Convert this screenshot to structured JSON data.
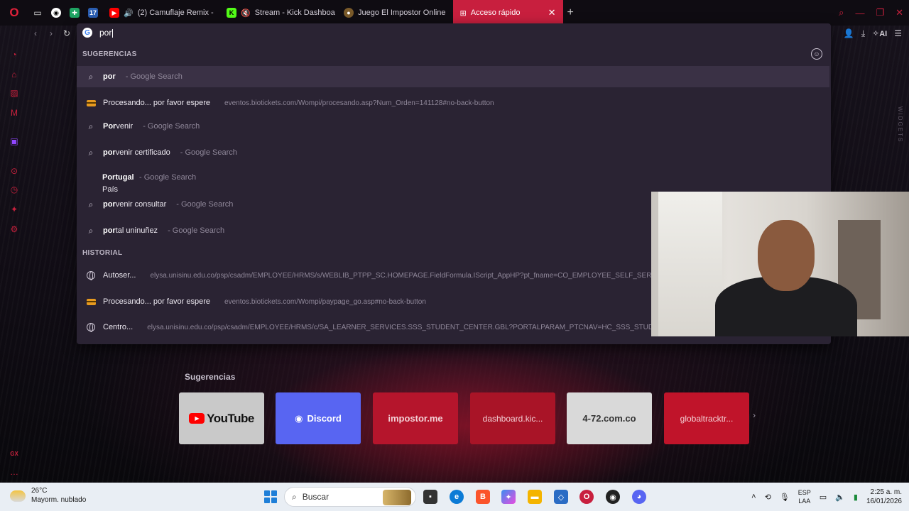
{
  "tabs": [
    {
      "title": "(2) Camuflaje Remix -",
      "favicon": "youtube-icon",
      "color": "#ff0000",
      "muted": false
    },
    {
      "title": "Stream - Kick Dashboa",
      "favicon": "kick-icon",
      "color": "#53fc18",
      "muted": true
    },
    {
      "title": "Juego El Impostor Online",
      "favicon": "impostor-icon",
      "color": "#7a5a2a",
      "muted": false
    },
    {
      "title": "Acceso rápido",
      "favicon": "speed-dial-icon",
      "color": "#c81f3e",
      "active": true
    }
  ],
  "pinned_tabs": [
    "tab-manager-icon",
    "chatgpt-icon",
    "sheets-icon",
    "seventeen-icon"
  ],
  "omnibox": {
    "typed_text": "por",
    "suggestions_header": "SUGERENCIAS",
    "history_header": "HISTORIAL",
    "suggestions": [
      {
        "bold": "por",
        "rest": "",
        "sub": "- Google Search",
        "icon": "search-icon",
        "selected": true
      },
      {
        "bold": "Procesando... por favor espere",
        "rest": "",
        "sub": "eventos.biotickets.com/Wompi/procesando.asp?Num_Orden=141128#no-back-button",
        "icon": "card-icon",
        "url": true
      },
      {
        "bold": "Por",
        "rest": "venir",
        "sub": "- Google Search",
        "icon": "search-icon"
      },
      {
        "bold": "por",
        "rest": "venir certificado",
        "sub": "- Google Search",
        "icon": "search-icon"
      },
      {
        "bold": "Portugal",
        "rest": "",
        "sub": "- Google Search",
        "icon": "none",
        "second_line": "País"
      },
      {
        "bold": "por",
        "rest": "venir consultar",
        "sub": "- Google Search",
        "icon": "search-icon"
      },
      {
        "bold": "por",
        "rest": "tal uninuñez",
        "sub": "- Google Search",
        "icon": "search-icon"
      }
    ],
    "history": [
      {
        "title": "Autoser...",
        "url": "elysa.unisinu.edu.co/psp/csadm/EMPLOYEE/HRMS/s/WEBLIB_PTPP_SC.HOMEPAGE.FieldFormula.IScript_AppHP?pt_fname=CO_EMPLOYEE_SELF_SERV",
        "icon": "globe-icon"
      },
      {
        "title": "Procesando... por favor espere",
        "url": "eventos.biotickets.com/Wompi/paypage_go.asp#no-back-button",
        "icon": "card-icon"
      },
      {
        "title": "Centro...",
        "url": "elysa.unisinu.edu.co/psp/csadm/EMPLOYEE/HRMS/c/SA_LEARNER_SERVICES.SSS_STUDENT_CENTER.GBL?PORTALPARAM_PTCNAV=HC_SSS_STUDEN",
        "icon": "globe-icon"
      }
    ]
  },
  "toolbar": {
    "ai_label": "AI"
  },
  "sidebar": {
    "widgets_label": "WIDGETS",
    "gx_label": "GX"
  },
  "speed_dial": {
    "title": "Sugerencias",
    "tiles": [
      {
        "label": "YouTube"
      },
      {
        "label": "Discord"
      },
      {
        "label": "impostor.me"
      },
      {
        "label": "dashboard.kic..."
      },
      {
        "label": "4-72.com.co"
      },
      {
        "label": "globaltracktr..."
      }
    ]
  },
  "taskbar": {
    "weather_temp": "26°C",
    "weather_desc": "Mayorm. nublado",
    "search_placeholder": "Buscar",
    "lang_top": "ESP",
    "lang_bottom": "LAA",
    "time": "2:25 a. m.",
    "date": "16/01/2026"
  },
  "colors": {
    "accent": "#c81f3e",
    "dropdown_bg": "#2a2333",
    "taskbar_bg": "#e9eef4"
  }
}
